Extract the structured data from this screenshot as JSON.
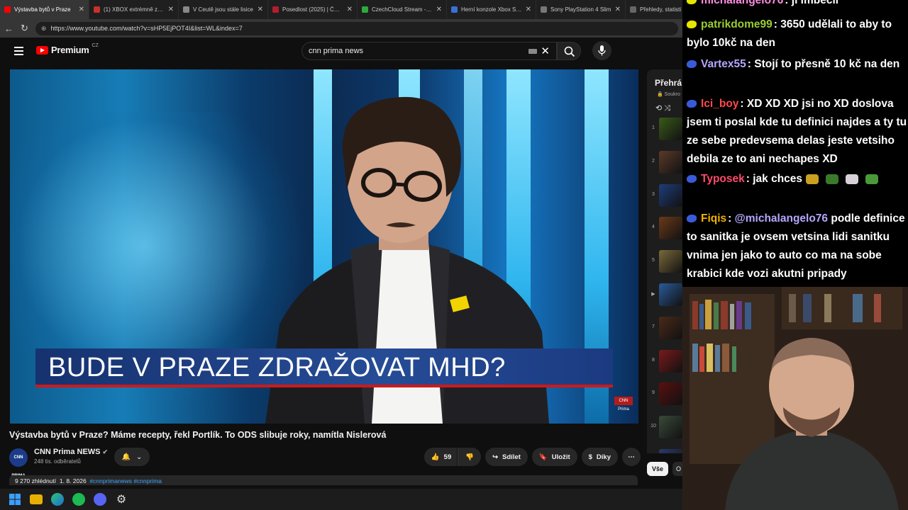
{
  "browser": {
    "tabs": [
      {
        "title": "Výstavba bytů v Praze",
        "fav": "#ff0000",
        "active": true
      },
      {
        "title": "(1) XBOX extrémně zdra",
        "fav": "#c9302c",
        "active": false
      },
      {
        "title": "V Ceutě jsou stále lisice",
        "fav": "#888888",
        "active": false
      },
      {
        "title": "Posedlost (2025) | ČSFD",
        "fav": "#b21e2e",
        "active": false
      },
      {
        "title": "CzechCloud Stream - W",
        "fav": "#2eaa3a",
        "active": false
      },
      {
        "title": "Herní konzole Xbox Seri",
        "fav": "#3a6fd8",
        "active": false
      },
      {
        "title": "Sony PlayStation 4 Slim",
        "fav": "#777777",
        "active": false
      },
      {
        "title": "Přehledy, statisti",
        "fav": "#666666",
        "active": false
      }
    ],
    "url": "https://www.youtube.com/watch?v=sHP5EjPOT4I&list=WL&index=7"
  },
  "youtube": {
    "logo": "Premium",
    "region": "CZ",
    "search_value": "cnn prima news"
  },
  "video": {
    "banner": "BUDE V PRAZE ZDRAŽOVAT MHD?",
    "bug": "CNN Prima",
    "title": "Výstavba bytů v Praze? Máme recepty, řekl Portlík. To ODS slibuje roky, namítla Nislerová",
    "channel": "CNN Prima NEWS",
    "channel_avatar": "CNN PRIMA",
    "subscribers": "248 tis. odběratelů",
    "likes": "59",
    "share": "Sdílet",
    "save": "Uložit",
    "thanks": "Díky",
    "views": "9 270 zhlédnutí",
    "date": "1. 8. 2026",
    "hashtags": "#cnnprimanews #cnnprima"
  },
  "playlist": {
    "header": "Přehrá",
    "sub": "Soukro",
    "items": [
      {
        "n": "1",
        "color": "#3a5a1a"
      },
      {
        "n": "2",
        "color": "#5a3a2a"
      },
      {
        "n": "3",
        "color": "#1f3d7a"
      },
      {
        "n": "4",
        "color": "#6a3a1a"
      },
      {
        "n": "5",
        "color": "#7a6a3a"
      },
      {
        "n": "▶",
        "color": "#2a5a9a"
      },
      {
        "n": "7",
        "color": "#4a2a1a"
      },
      {
        "n": "8",
        "color": "#7a1a1a"
      },
      {
        "n": "9",
        "color": "#5a1010"
      },
      {
        "n": "10",
        "color": "#3a4a3a"
      },
      {
        "n": "11",
        "color": "#2a3a6a"
      }
    ],
    "chip_all": "Vše",
    "chip_other": "O"
  },
  "chat": [
    {
      "user": "michalangelo76",
      "color": "#ff8ce0",
      "badge": "#e6e600",
      "text": ": ji imbecil"
    },
    {
      "user": "patrikdome99",
      "color": "#9acd32",
      "badge": "#e6e600",
      "text": ": 3650 udělali to aby to bylo 10kč na den"
    },
    {
      "user": "Vartex55",
      "color": "#b6a6ff",
      "badge": "#3a5bd9",
      "text": ": Stojí to přesně 10 kč na den"
    },
    {
      "user": "Ici_boy",
      "color": "#ff4a4a",
      "badge": "#3a5bd9",
      "text": ": XD XD XD jsi no XD doslova jsem ti poslal kde tu definici najdes a ty tu ze sebe predevsema delas jeste vetsiho debila ze to ani nechapes XD"
    },
    {
      "user": "Typosek",
      "color": "#ff4a6a",
      "badge": "#3a5bd9",
      "text": ": jak chces"
    },
    {
      "user": "Fiqis",
      "color": "#f2b200",
      "badge": "#3a5bd9",
      "mention": "@michalangelo76",
      "text": "podle definice to sanitka je ovsem vetsina lidi sanitku vnima jen jako to auto co ma na sobe krabici kde vozi akutni pripady"
    }
  ]
}
